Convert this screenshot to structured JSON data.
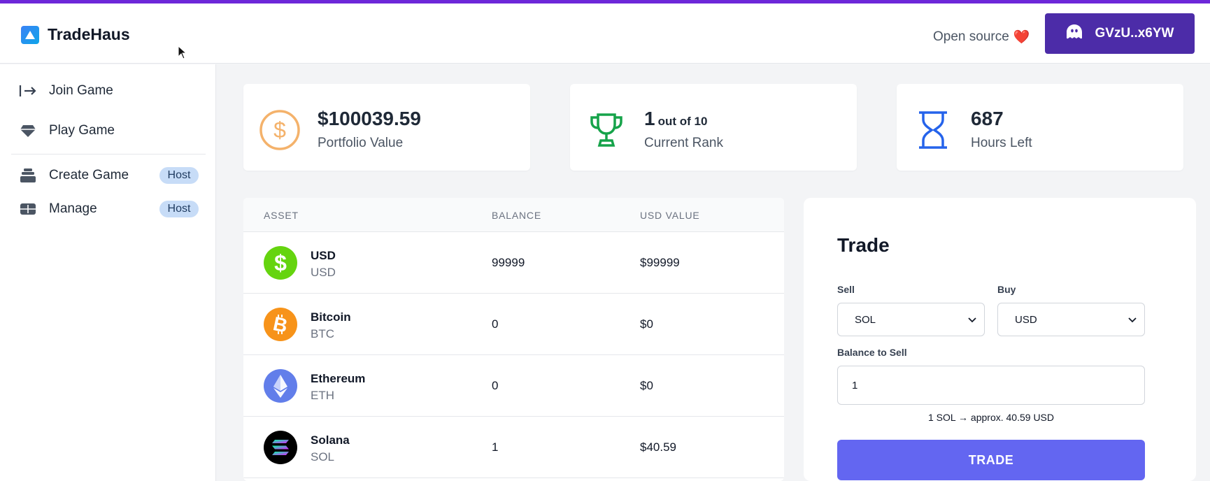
{
  "app": {
    "name": "TradeHaus",
    "open_source_label": "Open source",
    "heart": "❤️",
    "wallet_label": "GVzU..x6YW"
  },
  "sidebar": {
    "items": [
      {
        "label": "Join Game",
        "icon": "join-icon"
      },
      {
        "label": "Play Game",
        "icon": "diamond-icon"
      },
      {
        "label": "Create Game",
        "icon": "stack-icon",
        "badge": "Host"
      },
      {
        "label": "Manage",
        "icon": "grid-card-icon",
        "badge": "Host"
      }
    ]
  },
  "stats": {
    "portfolio": {
      "value": "$100039.59",
      "label": "Portfolio Value",
      "icon": "dollar-circle-icon",
      "color": "#f4a259"
    },
    "rank": {
      "value": "1",
      "sub": "out of 10",
      "label": "Current Rank",
      "icon": "trophy-icon",
      "color": "#16a34a"
    },
    "hours": {
      "value": "687",
      "label": "Hours Left",
      "icon": "hourglass-icon",
      "color": "#2563eb"
    }
  },
  "assets": {
    "headers": {
      "asset": "ASSET",
      "balance": "BALANCE",
      "usd_value": "USD VALUE"
    },
    "rows": [
      {
        "name": "USD",
        "symbol": "USD",
        "balance": "99999",
        "usd": "$99999",
        "icon": "usd-coin-icon",
        "color": "#65d40f"
      },
      {
        "name": "Bitcoin",
        "symbol": "BTC",
        "balance": "0",
        "usd": "$0",
        "icon": "bitcoin-icon",
        "color": "#f7931a"
      },
      {
        "name": "Ethereum",
        "symbol": "ETH",
        "balance": "0",
        "usd": "$0",
        "icon": "ethereum-icon",
        "color": "#627eea"
      },
      {
        "name": "Solana",
        "symbol": "SOL",
        "balance": "1",
        "usd": "$40.59",
        "icon": "solana-icon",
        "color": "#000000"
      }
    ]
  },
  "trade": {
    "title": "Trade",
    "sell_label": "Sell",
    "buy_label": "Buy",
    "sell_value": "SOL",
    "buy_value": "USD",
    "balance_label": "Balance to Sell",
    "balance_value": "1",
    "conversion_hint": "1 SOL → approx. 40.59 USD",
    "button_label": "TRADE",
    "button_color": "#6366f1"
  }
}
